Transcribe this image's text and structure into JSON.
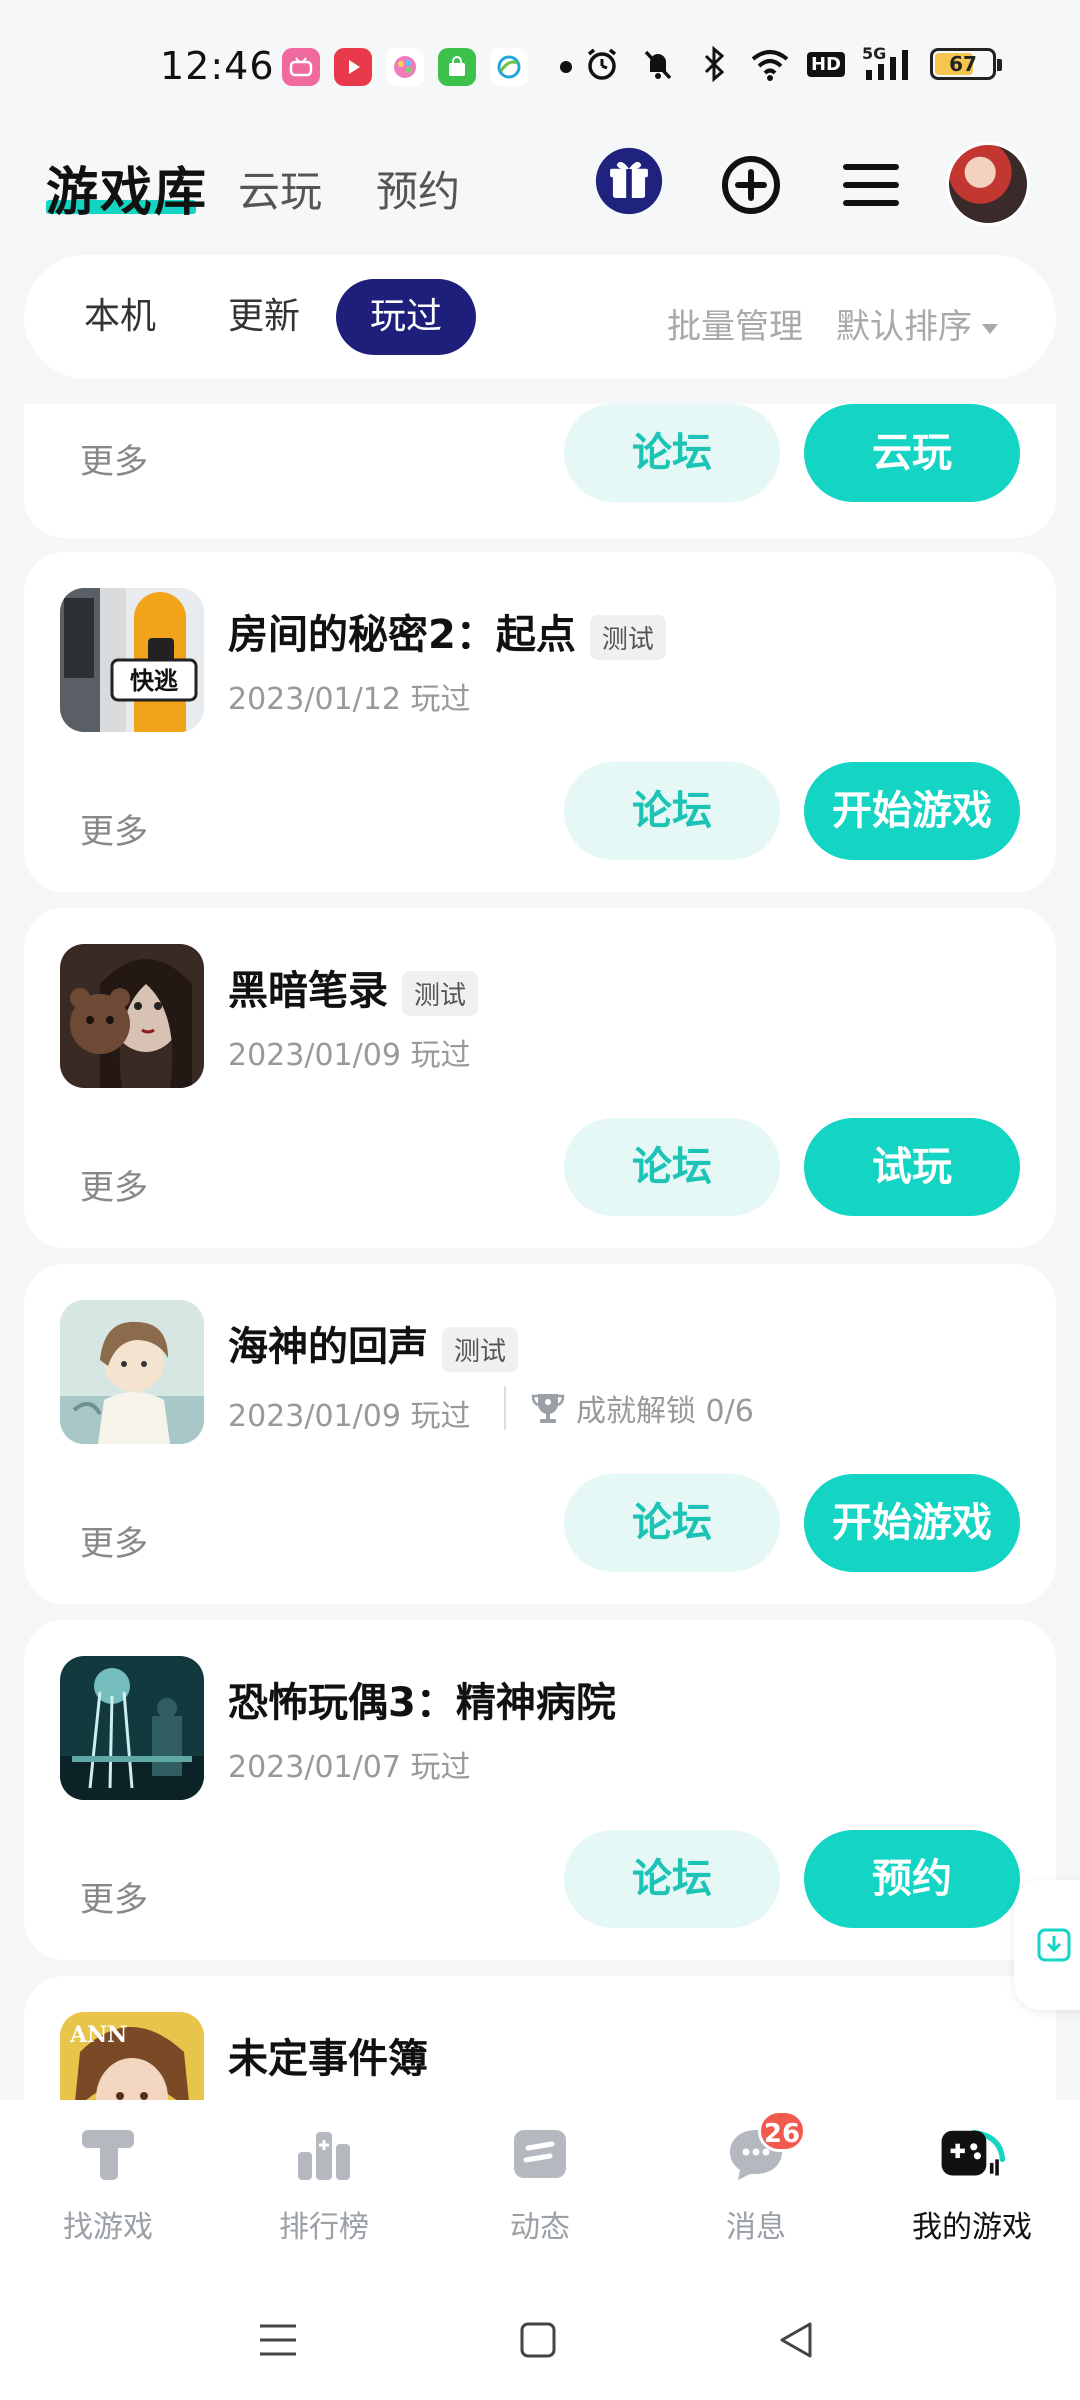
{
  "status_bar": {
    "time": "12:46",
    "battery": "67",
    "network": "5G",
    "hd": "HD"
  },
  "header": {
    "logo": "游戏库",
    "tabs": [
      "云玩",
      "预约"
    ]
  },
  "filter": {
    "tabs": [
      "本机",
      "更新",
      "玩过"
    ],
    "active_tab": "玩过",
    "batch_manage": "批量管理",
    "sort": "默认排序"
  },
  "partial_card": {
    "more": "更多",
    "forum": "论坛",
    "action": "云玩"
  },
  "games": [
    {
      "title": "房间的秘密2：起点",
      "tag": "测试",
      "date": "2023/01/12 玩过",
      "more": "更多",
      "forum": "论坛",
      "action": "开始游戏",
      "icon_text": "快逃"
    },
    {
      "title": "黑暗笔录",
      "tag": "测试",
      "date": "2023/01/09 玩过",
      "more": "更多",
      "forum": "论坛",
      "action": "试玩"
    },
    {
      "title": "海神的回声",
      "tag": "测试",
      "date": "2023/01/09 玩过",
      "achievement": "成就解锁 0/6",
      "more": "更多",
      "forum": "论坛",
      "action": "开始游戏"
    },
    {
      "title": "恐怖玩偶3：精神病院",
      "tag": "",
      "date": "2023/01/07 玩过",
      "more": "更多",
      "forum": "论坛",
      "action": "预约"
    },
    {
      "title": "未定事件簿",
      "icon_text": "ANN"
    }
  ],
  "bottom_nav": [
    {
      "label": "找游戏"
    },
    {
      "label": "排行榜"
    },
    {
      "label": "动态"
    },
    {
      "label": "消息",
      "badge": "26"
    },
    {
      "label": "我的游戏"
    }
  ]
}
